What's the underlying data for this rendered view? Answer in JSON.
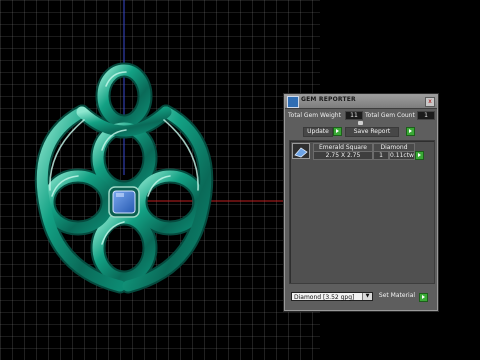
{
  "app": {
    "panel_title": "GEM REPORTER",
    "close_glyph": "x"
  },
  "summary": {
    "weight_label": "Total Gem Weight",
    "weight_value": "11",
    "count_label": "Total Gem Count",
    "count_value": "1"
  },
  "actions": {
    "update_label": "Update",
    "save_label": "Save Report",
    "set_material_label": "Set Material"
  },
  "table": {
    "headers": [
      "Emerald Square",
      "Diamond"
    ],
    "row": {
      "size": "2.75 X 2.75",
      "count": "1",
      "weight": "0.11ctw"
    }
  },
  "material_select": {
    "value": "Diamond  [3.52 gpg]"
  },
  "colors": {
    "ring": "#0f8a73",
    "ring_highlight": "#7ee2c6",
    "gem": "#3c74cf",
    "panel_bg": "#5e5e5e",
    "arrow_green": "#3aa936"
  },
  "icons": {
    "title_icon": "gem-report-icon",
    "row_icon": "gem-thumbnail-icon"
  }
}
